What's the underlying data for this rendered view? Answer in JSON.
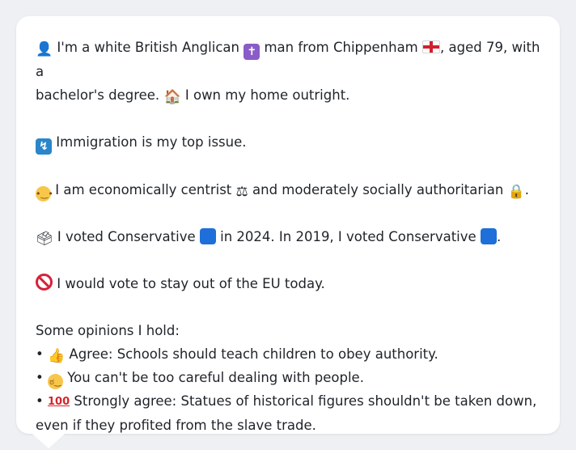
{
  "profile": {
    "intro_line1_a": "I'm a white British Anglican",
    "intro_line1_b": "man from Chippenham",
    "intro_line1_c": ", aged 79, with a",
    "intro_line2_a": "bachelor's degree.",
    "intro_line2_b": "I own my home outright.",
    "issue": "Immigration is my top issue.",
    "economic_a": "I am economically centrist",
    "economic_b": "and moderately socially authoritarian",
    "economic_c": ".",
    "vote_a": "I voted Conservative",
    "vote_b": "in 2024. In 2019, I voted Conservative",
    "vote_c": ".",
    "eu": "I would vote to stay out of the EU today.",
    "opinions_heading": "Some opinions I hold:",
    "opinions": [
      {
        "bullet": "•",
        "text": "Agree: Schools should teach children to obey authority."
      },
      {
        "bullet": "•",
        "text": "You can't be too careful dealing with people."
      },
      {
        "bullet": "•",
        "text": "Strongly agree: Statues of historical figures shouldn't be taken down,"
      },
      {
        "bullet": "",
        "text": "even if they profited from the slave trade."
      }
    ]
  },
  "icons": {
    "person": "👤",
    "cross": "✝",
    "house": "🏠",
    "arrows": "↯",
    "scales": "⚖",
    "lock": "🔒",
    "thumbs": "👍",
    "hundred": "100"
  },
  "colors": {
    "background": "#eef0f3",
    "bubble": "#ffffff",
    "conservative_blue": "#1e6fd9"
  }
}
